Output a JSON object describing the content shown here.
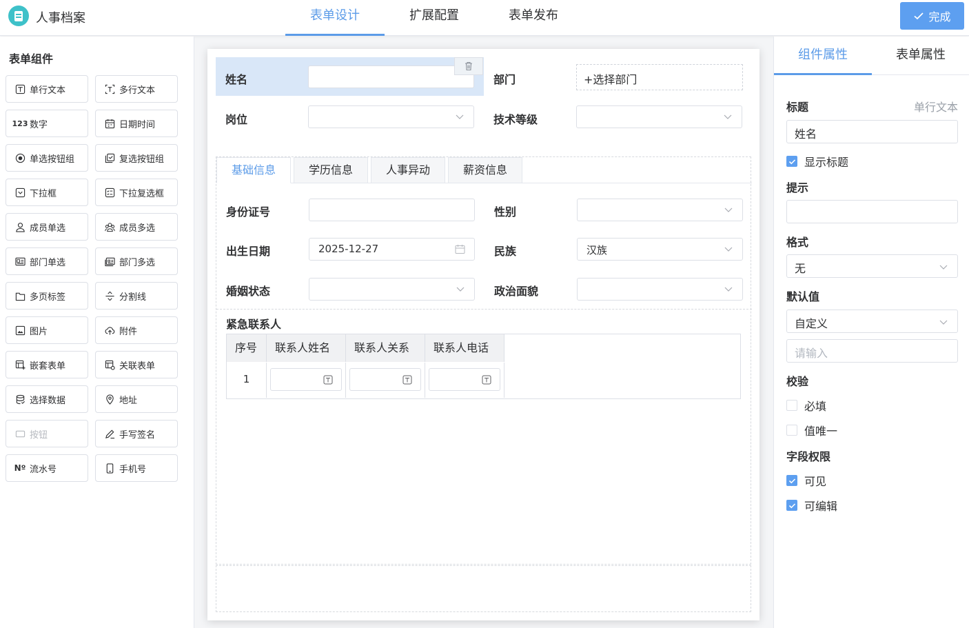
{
  "app": {
    "title": "人事档案"
  },
  "top_tabs": [
    {
      "label": "表单设计",
      "active": true
    },
    {
      "label": "扩展配置",
      "active": false
    },
    {
      "label": "表单发布",
      "active": false
    }
  ],
  "done_label": "完成",
  "left": {
    "title": "表单组件",
    "components": [
      {
        "label": "单行文本",
        "icon": "text-input-icon"
      },
      {
        "label": "多行文本",
        "icon": "textarea-icon"
      },
      {
        "label": "数字",
        "icon": "number-icon"
      },
      {
        "label": "日期时间",
        "icon": "calendar-icon"
      },
      {
        "label": "单选按钮组",
        "icon": "radio-icon"
      },
      {
        "label": "复选按钮组",
        "icon": "checkbox-icon"
      },
      {
        "label": "下拉框",
        "icon": "dropdown-icon"
      },
      {
        "label": "下拉复选框",
        "icon": "multi-dropdown-icon"
      },
      {
        "label": "成员单选",
        "icon": "user-icon"
      },
      {
        "label": "成员多选",
        "icon": "users-icon"
      },
      {
        "label": "部门单选",
        "icon": "dept-icon"
      },
      {
        "label": "部门多选",
        "icon": "depts-icon"
      },
      {
        "label": "多页标签",
        "icon": "tabs-icon"
      },
      {
        "label": "分割线",
        "icon": "divider-icon"
      },
      {
        "label": "图片",
        "icon": "image-icon"
      },
      {
        "label": "附件",
        "icon": "upload-icon"
      },
      {
        "label": "嵌套表单",
        "icon": "nested-form-icon"
      },
      {
        "label": "关联表单",
        "icon": "linked-form-icon"
      },
      {
        "label": "选择数据",
        "icon": "database-icon"
      },
      {
        "label": "地址",
        "icon": "location-icon"
      },
      {
        "label": "按钮",
        "icon": "button-icon",
        "disabled": true
      },
      {
        "label": "手写签名",
        "icon": "signature-icon"
      },
      {
        "label": "流水号",
        "icon": "serial-number-icon"
      },
      {
        "label": "手机号",
        "icon": "mobile-icon"
      }
    ]
  },
  "form": {
    "name_label": "姓名",
    "dept_label": "部门",
    "dept_button": "+选择部门",
    "position_label": "岗位",
    "tech_level_label": "技术等级",
    "tabs": [
      {
        "label": "基础信息",
        "active": true
      },
      {
        "label": "学历信息",
        "active": false
      },
      {
        "label": "人事异动",
        "active": false
      },
      {
        "label": "薪资信息",
        "active": false
      }
    ],
    "id_label": "身份证号",
    "gender_label": "性别",
    "birth_label": "出生日期",
    "birth_value": "2025-12-27",
    "ethnicity_label": "民族",
    "ethnicity_value": "汉族",
    "marital_label": "婚姻状态",
    "political_label": "政治面貌",
    "emergency": {
      "title": "紧急联系人",
      "columns": [
        "序号",
        "联系人姓名",
        "联系人关系",
        "联系人电话"
      ],
      "rows": [
        {
          "index": "1"
        }
      ]
    }
  },
  "right": {
    "tabs": [
      {
        "label": "组件属性",
        "active": true
      },
      {
        "label": "表单属性",
        "active": false
      }
    ],
    "title_label": "标题",
    "title_type": "单行文本",
    "title_value": "姓名",
    "show_title_label": "显示标题",
    "show_title_checked": true,
    "hint_label": "提示",
    "hint_value": "",
    "format_label": "格式",
    "format_value": "无",
    "default_label": "默认值",
    "default_value": "自定义",
    "default_placeholder": "请输入",
    "validation_label": "校验",
    "required_label": "必填",
    "required_checked": false,
    "unique_label": "值唯一",
    "unique_checked": false,
    "permission_label": "字段权限",
    "visible_label": "可见",
    "visible_checked": true,
    "editable_label": "可编辑",
    "editable_checked": true
  },
  "colors": {
    "accent": "#5b9be8",
    "button": "#5d9ff0",
    "logo": "#3ec1c9",
    "selected_bg": "#d9e7f8"
  }
}
